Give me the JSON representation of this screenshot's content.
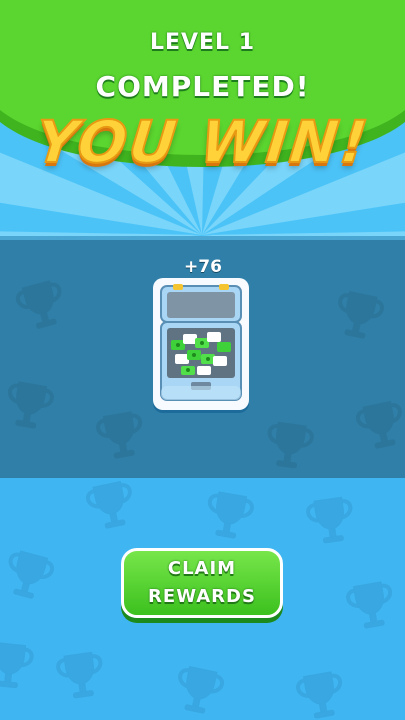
{
  "header": {
    "level_text": "LEVEL 1",
    "completed_text": "COMPLETED!",
    "win_text": "YOU WIN!"
  },
  "reward": {
    "amount_text": "+76",
    "icon": "money-briefcase-icon"
  },
  "claim_button": {
    "label": "CLAIM\nREWARDS"
  },
  "background": {
    "pattern_icon": "trophy-icon"
  },
  "colors": {
    "header_green": "#5bd52f",
    "ray_blue": "#4fc0f5",
    "panel_dark_blue": "#2f7fa8",
    "bottom_blue": "#3fb6f2",
    "win_yellow": "#ffd23a",
    "button_green": "#52d12a"
  }
}
